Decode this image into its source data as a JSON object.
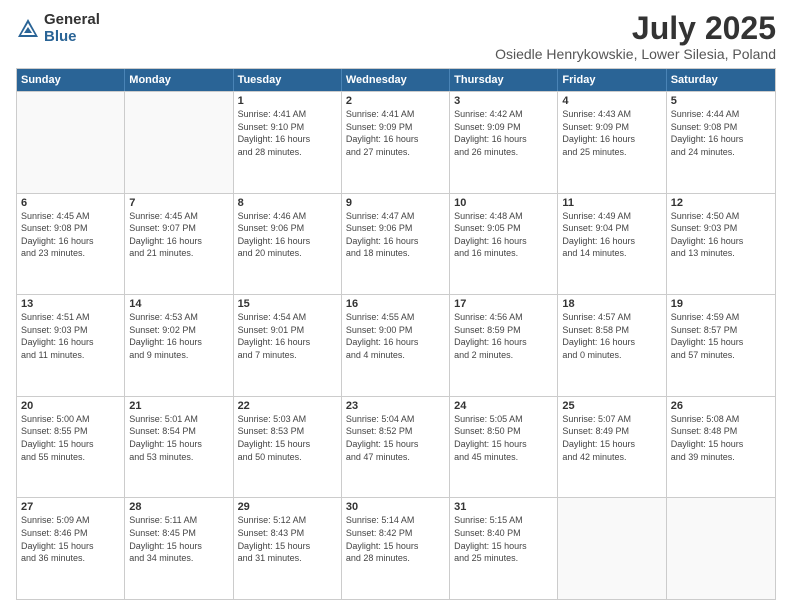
{
  "header": {
    "logo_general": "General",
    "logo_blue": "Blue",
    "month_year": "July 2025",
    "location": "Osiedle Henrykowskie, Lower Silesia, Poland"
  },
  "days_of_week": [
    "Sunday",
    "Monday",
    "Tuesday",
    "Wednesday",
    "Thursday",
    "Friday",
    "Saturday"
  ],
  "weeks": [
    [
      {
        "day": "",
        "info": ""
      },
      {
        "day": "",
        "info": ""
      },
      {
        "day": "1",
        "info": "Sunrise: 4:41 AM\nSunset: 9:10 PM\nDaylight: 16 hours\nand 28 minutes."
      },
      {
        "day": "2",
        "info": "Sunrise: 4:41 AM\nSunset: 9:09 PM\nDaylight: 16 hours\nand 27 minutes."
      },
      {
        "day": "3",
        "info": "Sunrise: 4:42 AM\nSunset: 9:09 PM\nDaylight: 16 hours\nand 26 minutes."
      },
      {
        "day": "4",
        "info": "Sunrise: 4:43 AM\nSunset: 9:09 PM\nDaylight: 16 hours\nand 25 minutes."
      },
      {
        "day": "5",
        "info": "Sunrise: 4:44 AM\nSunset: 9:08 PM\nDaylight: 16 hours\nand 24 minutes."
      }
    ],
    [
      {
        "day": "6",
        "info": "Sunrise: 4:45 AM\nSunset: 9:08 PM\nDaylight: 16 hours\nand 23 minutes."
      },
      {
        "day": "7",
        "info": "Sunrise: 4:45 AM\nSunset: 9:07 PM\nDaylight: 16 hours\nand 21 minutes."
      },
      {
        "day": "8",
        "info": "Sunrise: 4:46 AM\nSunset: 9:06 PM\nDaylight: 16 hours\nand 20 minutes."
      },
      {
        "day": "9",
        "info": "Sunrise: 4:47 AM\nSunset: 9:06 PM\nDaylight: 16 hours\nand 18 minutes."
      },
      {
        "day": "10",
        "info": "Sunrise: 4:48 AM\nSunset: 9:05 PM\nDaylight: 16 hours\nand 16 minutes."
      },
      {
        "day": "11",
        "info": "Sunrise: 4:49 AM\nSunset: 9:04 PM\nDaylight: 16 hours\nand 14 minutes."
      },
      {
        "day": "12",
        "info": "Sunrise: 4:50 AM\nSunset: 9:03 PM\nDaylight: 16 hours\nand 13 minutes."
      }
    ],
    [
      {
        "day": "13",
        "info": "Sunrise: 4:51 AM\nSunset: 9:03 PM\nDaylight: 16 hours\nand 11 minutes."
      },
      {
        "day": "14",
        "info": "Sunrise: 4:53 AM\nSunset: 9:02 PM\nDaylight: 16 hours\nand 9 minutes."
      },
      {
        "day": "15",
        "info": "Sunrise: 4:54 AM\nSunset: 9:01 PM\nDaylight: 16 hours\nand 7 minutes."
      },
      {
        "day": "16",
        "info": "Sunrise: 4:55 AM\nSunset: 9:00 PM\nDaylight: 16 hours\nand 4 minutes."
      },
      {
        "day": "17",
        "info": "Sunrise: 4:56 AM\nSunset: 8:59 PM\nDaylight: 16 hours\nand 2 minutes."
      },
      {
        "day": "18",
        "info": "Sunrise: 4:57 AM\nSunset: 8:58 PM\nDaylight: 16 hours\nand 0 minutes."
      },
      {
        "day": "19",
        "info": "Sunrise: 4:59 AM\nSunset: 8:57 PM\nDaylight: 15 hours\nand 57 minutes."
      }
    ],
    [
      {
        "day": "20",
        "info": "Sunrise: 5:00 AM\nSunset: 8:55 PM\nDaylight: 15 hours\nand 55 minutes."
      },
      {
        "day": "21",
        "info": "Sunrise: 5:01 AM\nSunset: 8:54 PM\nDaylight: 15 hours\nand 53 minutes."
      },
      {
        "day": "22",
        "info": "Sunrise: 5:03 AM\nSunset: 8:53 PM\nDaylight: 15 hours\nand 50 minutes."
      },
      {
        "day": "23",
        "info": "Sunrise: 5:04 AM\nSunset: 8:52 PM\nDaylight: 15 hours\nand 47 minutes."
      },
      {
        "day": "24",
        "info": "Sunrise: 5:05 AM\nSunset: 8:50 PM\nDaylight: 15 hours\nand 45 minutes."
      },
      {
        "day": "25",
        "info": "Sunrise: 5:07 AM\nSunset: 8:49 PM\nDaylight: 15 hours\nand 42 minutes."
      },
      {
        "day": "26",
        "info": "Sunrise: 5:08 AM\nSunset: 8:48 PM\nDaylight: 15 hours\nand 39 minutes."
      }
    ],
    [
      {
        "day": "27",
        "info": "Sunrise: 5:09 AM\nSunset: 8:46 PM\nDaylight: 15 hours\nand 36 minutes."
      },
      {
        "day": "28",
        "info": "Sunrise: 5:11 AM\nSunset: 8:45 PM\nDaylight: 15 hours\nand 34 minutes."
      },
      {
        "day": "29",
        "info": "Sunrise: 5:12 AM\nSunset: 8:43 PM\nDaylight: 15 hours\nand 31 minutes."
      },
      {
        "day": "30",
        "info": "Sunrise: 5:14 AM\nSunset: 8:42 PM\nDaylight: 15 hours\nand 28 minutes."
      },
      {
        "day": "31",
        "info": "Sunrise: 5:15 AM\nSunset: 8:40 PM\nDaylight: 15 hours\nand 25 minutes."
      },
      {
        "day": "",
        "info": ""
      },
      {
        "day": "",
        "info": ""
      }
    ]
  ]
}
